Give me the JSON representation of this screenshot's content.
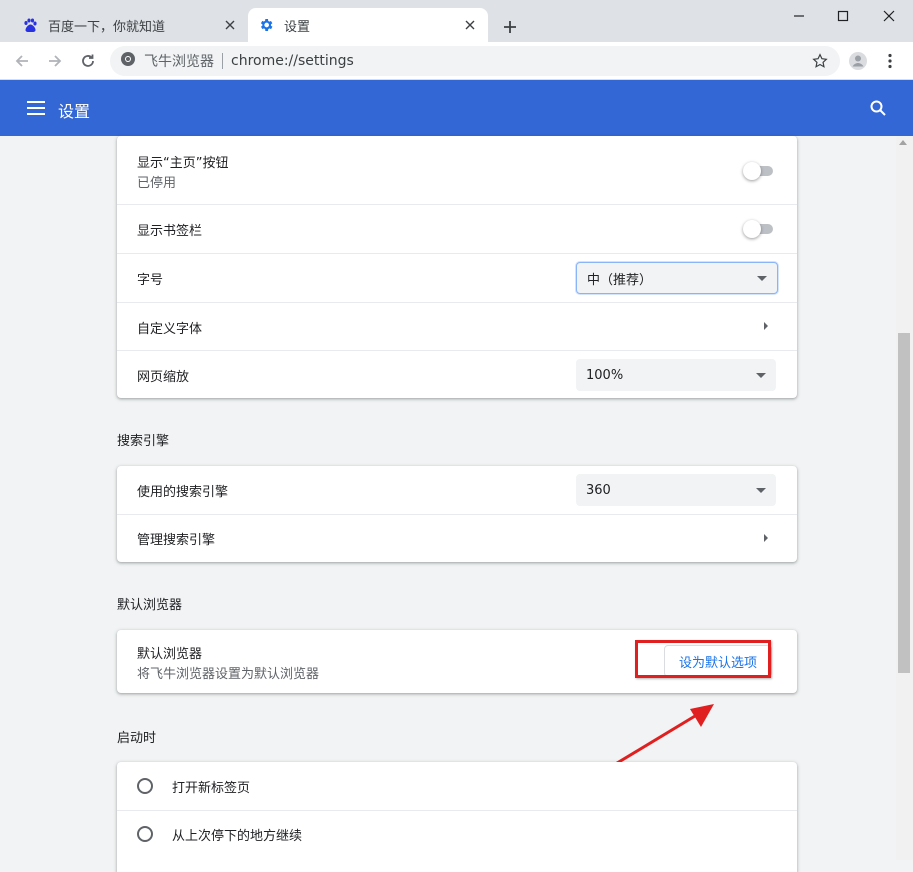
{
  "tabs": [
    {
      "title": "百度一下，你就知道",
      "icon": "baidu-paw-icon",
      "active": false
    },
    {
      "title": "设置",
      "icon": "gear-icon",
      "active": true
    }
  ],
  "address_bar": {
    "site_name": "飞牛浏览器",
    "url": "chrome://settings"
  },
  "header": {
    "title": "设置"
  },
  "appearance": {
    "home_button": {
      "label": "显示“主页”按钮",
      "sub": "已停用",
      "enabled": false
    },
    "bookmarks_bar": {
      "label": "显示书签栏",
      "enabled": false
    },
    "font_size": {
      "label": "字号",
      "value": "中（推荐）"
    },
    "custom_fonts": {
      "label": "自定义字体"
    },
    "page_zoom": {
      "label": "网页缩放",
      "value": "100%"
    }
  },
  "search_engine": {
    "heading": "搜索引擎",
    "used": {
      "label": "使用的搜索引擎",
      "value": "360"
    },
    "manage": {
      "label": "管理搜索引擎"
    }
  },
  "default_browser": {
    "heading": "默认浏览器",
    "label": "默认浏览器",
    "sub": "将飞牛浏览器设置为默认浏览器",
    "button": "设为默认选项"
  },
  "on_startup": {
    "heading": "启动时",
    "options": [
      "打开新标签页",
      "从上次停下的地方继续"
    ]
  },
  "colors": {
    "header_blue": "#3367d6",
    "link_blue": "#1a73e8",
    "highlight_red": "#e02020"
  }
}
